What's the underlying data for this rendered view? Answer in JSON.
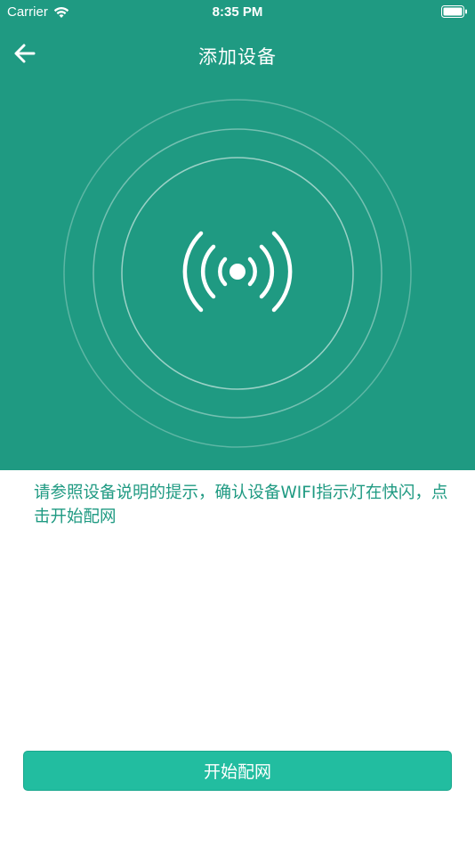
{
  "status_bar": {
    "carrier": "Carrier",
    "time": "8:35 PM",
    "wifi_icon": "wifi-icon",
    "battery_icon": "battery-icon"
  },
  "nav": {
    "back_icon": "arrow-left-icon",
    "title": "添加设备"
  },
  "hero": {
    "background_color": "#1f9a82",
    "signal_icon": "broadcast-signal-icon"
  },
  "instruction": {
    "text": "请参照设备说明的提示，确认设备WIFI指示灯在快闪，点击开始配网",
    "color": "#1f9a82"
  },
  "actions": {
    "start_label": "开始配网",
    "button_color": "#22bda0"
  }
}
